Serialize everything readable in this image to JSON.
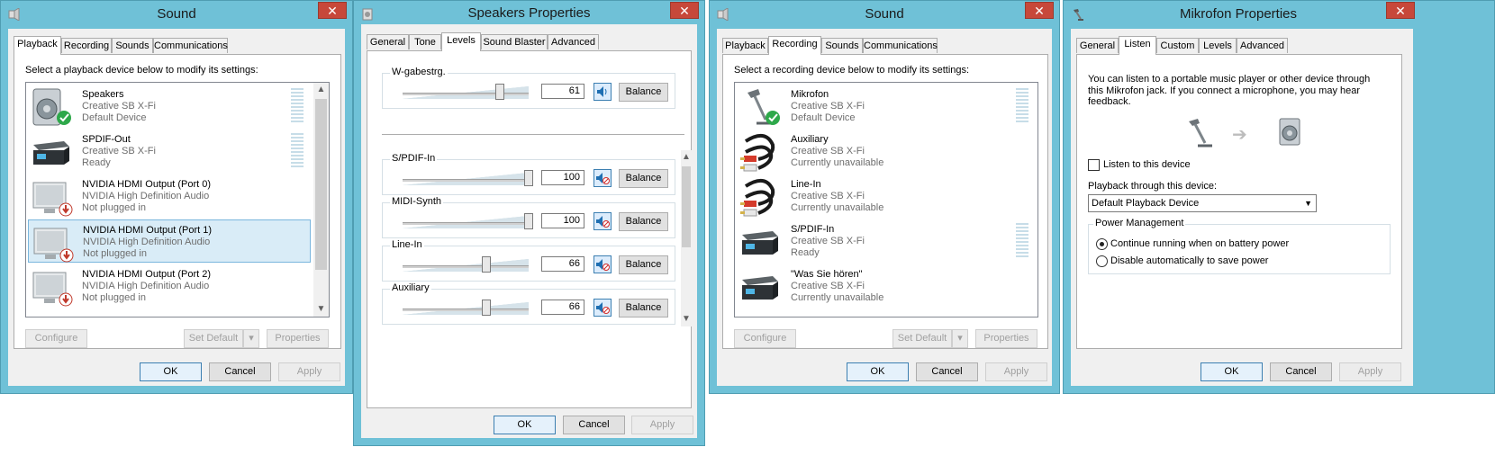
{
  "sound_playback": {
    "title": "Sound",
    "close_glyph": "✕",
    "tabs": [
      "Playback",
      "Recording",
      "Sounds",
      "Communications"
    ],
    "instruction": "Select a playback device below to modify its settings:",
    "devices": [
      {
        "name": "Speakers",
        "line1": "Creative SB X-Fi",
        "line2": "Default Device",
        "icon": "speaker-icon",
        "status": "default-check"
      },
      {
        "name": "SPDIF-Out",
        "line1": "Creative SB X-Fi",
        "line2": "Ready",
        "icon": "spdif-device-icon",
        "status": "none"
      },
      {
        "name": "NVIDIA HDMI Output (Port 0)",
        "line1": "NVIDIA High Definition Audio",
        "line2": "Not plugged in",
        "icon": "monitor-icon",
        "status": "unplugged"
      },
      {
        "name": "NVIDIA HDMI Output (Port 1)",
        "line1": "NVIDIA High Definition Audio",
        "line2": "Not plugged in",
        "icon": "monitor-icon",
        "status": "unplugged"
      },
      {
        "name": "NVIDIA HDMI Output (Port 2)",
        "line1": "NVIDIA High Definition Audio",
        "line2": "Not plugged in",
        "icon": "monitor-icon",
        "status": "unplugged"
      }
    ],
    "buttons": {
      "configure": "Configure",
      "set_default": "Set Default",
      "properties": "Properties",
      "ok": "OK",
      "cancel": "Cancel",
      "apply": "Apply"
    }
  },
  "speakers_properties": {
    "title": "Speakers Properties",
    "close_glyph": "✕",
    "tabs": [
      "General",
      "Tone",
      "Levels",
      "Sound Blaster",
      "Advanced"
    ],
    "master": {
      "label": "W-gabestrg.",
      "value": "61",
      "level": 0.61
    },
    "channels": [
      {
        "label": "S/PDIF-In",
        "value": "100",
        "level": 1.0,
        "muted": true
      },
      {
        "label": "MIDI-Synth",
        "value": "100",
        "level": 1.0,
        "muted": true
      },
      {
        "label": "Line-In",
        "value": "66",
        "level": 0.66,
        "muted": true
      },
      {
        "label": "Auxiliary",
        "value": "66",
        "level": 0.66,
        "muted": true
      }
    ],
    "balance_label": "Balance",
    "buttons": {
      "ok": "OK",
      "cancel": "Cancel",
      "apply": "Apply"
    }
  },
  "sound_recording": {
    "title": "Sound",
    "close_glyph": "✕",
    "tabs": [
      "Playback",
      "Recording",
      "Sounds",
      "Communications"
    ],
    "instruction": "Select a recording device below to modify its settings:",
    "devices": [
      {
        "name": "Mikrofon",
        "line1": "Creative SB X-Fi",
        "line2": "Default Device",
        "icon": "microphone-icon",
        "status": "default-check"
      },
      {
        "name": "Auxiliary",
        "line1": "Creative SB X-Fi",
        "line2": "Currently unavailable",
        "icon": "rca-cable-icon",
        "status": "none"
      },
      {
        "name": "Line-In",
        "line1": "Creative SB X-Fi",
        "line2": "Currently unavailable",
        "icon": "rca-cable-icon",
        "status": "none"
      },
      {
        "name": "S/PDIF-In",
        "line1": "Creative SB X-Fi",
        "line2": "Ready",
        "icon": "spdif-device-icon",
        "status": "none"
      },
      {
        "name": "\"Was Sie hören\"",
        "line1": "Creative SB X-Fi",
        "line2": "Currently unavailable",
        "icon": "spdif-device-icon",
        "status": "none"
      }
    ],
    "buttons": {
      "configure": "Configure",
      "set_default": "Set Default",
      "properties": "Properties",
      "ok": "OK",
      "cancel": "Cancel",
      "apply": "Apply"
    }
  },
  "mikrofon_properties": {
    "title": "Mikrofon Properties",
    "close_glyph": "✕",
    "tabs": [
      "General",
      "Listen",
      "Custom",
      "Levels",
      "Advanced"
    ],
    "description": "You can listen to a portable music player or other device through this Mikrofon jack.  If you connect a microphone, you may hear feedback.",
    "arrow_glyph": "➔",
    "listen_checkbox": "Listen to this device",
    "listen_checked": false,
    "playback_label": "Playback through this device:",
    "playback_value": "Default Playback Device",
    "power_group": "Power Management",
    "power_options": [
      "Continue running when on battery power",
      "Disable automatically to save power"
    ],
    "power_selected": 0,
    "buttons": {
      "ok": "OK",
      "cancel": "Cancel",
      "apply": "Apply"
    }
  }
}
